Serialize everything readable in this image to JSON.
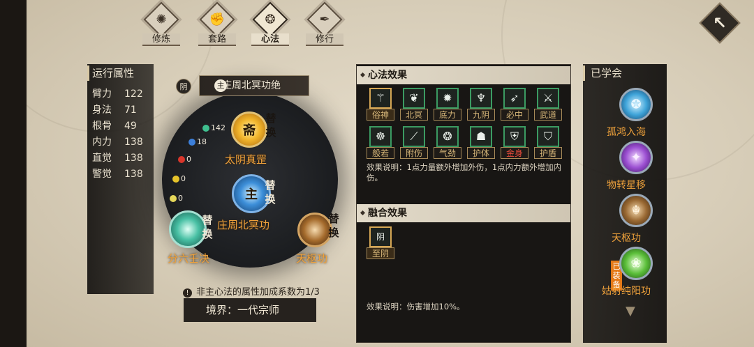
{
  "tabs": [
    {
      "label": "修炼",
      "icon": "flame-emblem-icon"
    },
    {
      "label": "套路",
      "icon": "fist-emblem-icon"
    },
    {
      "label": "心法",
      "icon": "swirl-emblem-icon",
      "active": true
    },
    {
      "label": "修行",
      "icon": "scroll-emblem-icon"
    }
  ],
  "close_symbol": "↖",
  "attributes": {
    "title": "运行属性",
    "items": [
      {
        "label": "臂力",
        "value": "122"
      },
      {
        "label": "身法",
        "value": "71"
      },
      {
        "label": "根骨",
        "value": "49"
      },
      {
        "label": "内力",
        "value": "138"
      },
      {
        "label": "直觉",
        "value": "138"
      },
      {
        "label": "警觉",
        "value": "138"
      }
    ]
  },
  "formation": {
    "yin_label": "阴",
    "main_badge": "主",
    "main_skill": "庄周北冥功",
    "main_tag": "绝",
    "replace": [
      "替",
      "换"
    ],
    "skills": {
      "taiyin": "太阴真罡",
      "zhuangzhou": "庄周北冥功",
      "fenliu": "分六壬决",
      "tianshu": "天枢功"
    },
    "orb_glyphs": {
      "taiyin": "斋",
      "zhuangzhou": "主",
      "fenliu": "",
      "tianshu": ""
    },
    "mini_stats": [
      {
        "label": "142",
        "color": "#3fbf8f"
      },
      {
        "label": "18",
        "color": "#3c7fd9"
      },
      {
        "label": "0",
        "color": "#d9362b"
      },
      {
        "label": "0",
        "color": "#e5c22a"
      },
      {
        "label": "0",
        "color": "#e5d75a"
      }
    ],
    "badge_small": "阴"
  },
  "hint": "非主心法的属性加成系数为1/3",
  "realm": "境界：一代宗师",
  "effects": {
    "title": "心法效果",
    "items": [
      {
        "label": "俗神",
        "glyph": "⚚",
        "style": "gold"
      },
      {
        "label": "北冥",
        "glyph": "❦",
        "style": "normal"
      },
      {
        "label": "底力",
        "glyph": "✹",
        "style": "normal"
      },
      {
        "label": "九阴",
        "glyph": "♆",
        "style": "normal"
      },
      {
        "label": "必中",
        "glyph": "➶",
        "style": "normal"
      },
      {
        "label": "武道",
        "glyph": "⚔",
        "style": "normal"
      },
      {
        "label": "般若",
        "glyph": "☸",
        "style": "normal"
      },
      {
        "label": "附伤",
        "glyph": "⟋",
        "style": "normal"
      },
      {
        "label": "气劲",
        "glyph": "❂",
        "style": "normal"
      },
      {
        "label": "护体",
        "glyph": "☗",
        "style": "normal"
      },
      {
        "label": "金身",
        "glyph": "⛨",
        "style": "red"
      },
      {
        "label": "护盾",
        "glyph": "⛉",
        "style": "normal"
      }
    ],
    "description": "效果说明：1点力量额外增加外伤，1点内力额外增加内伤。"
  },
  "fusion": {
    "title": "融合效果",
    "items": [
      {
        "label": "至阴",
        "glyph": "阴",
        "style": "gold"
      }
    ],
    "description": "效果说明：伤害增加10%。"
  },
  "learned": {
    "title": "已学会",
    "equipped_label": "已装备",
    "items": [
      {
        "name": "孤鸿入海",
        "color": "#3fa4d9",
        "glyph": "✪"
      },
      {
        "name": "物转星移",
        "color": "#9b4fd1",
        "glyph": "✦"
      },
      {
        "name": "天枢功",
        "color": "#9a6a34",
        "glyph": "☬"
      },
      {
        "name": "姑射纯阳功",
        "color": "#5bbf3a",
        "glyph": "❀"
      }
    ]
  }
}
